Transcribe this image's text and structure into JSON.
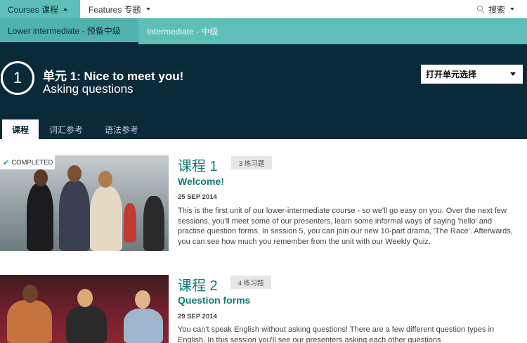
{
  "nav": {
    "courses_label": "Courses 课程",
    "features_label": "Features 专题",
    "search_label": "搜索"
  },
  "levels": {
    "active_label": "Lower intermediate - 预备中级",
    "other_label": "Intermediate - 中级"
  },
  "unit": {
    "number": "1",
    "title": "单元 1: Nice to meet you!",
    "subtitle": "Asking questions",
    "select_label": "打开单元选择"
  },
  "subtabs": {
    "course": "课程",
    "vocab": "词汇参考",
    "grammar": "语法参考"
  },
  "colors": {
    "teal": "#5ebfb8",
    "navy": "#0a2a3a",
    "lesson_title": "#117a76"
  },
  "lessons": [
    {
      "number_label": "课程 1",
      "badge": "3 练习题",
      "status": "COMPLETED",
      "title": "Welcome!",
      "date": "25 SEP 2014",
      "description": "This is the first unit of our lower-intermediate course - so we'll go easy on you. Over the next few sessions, you'll meet some of our presenters, learn some informal ways of saying 'hello' and practise question forms. In session 5, you can join our new 10-part drama, 'The Race'. Afterwards, you can see how much you remember from the unit with our Weekly Quiz."
    },
    {
      "number_label": "课程 2",
      "badge": "4 练习题",
      "title": "Question forms",
      "date": "29 SEP 2014",
      "description": "You can't speak English without asking questions! There are a few different question types in English. In this session you'll see our presenters asking each other questions"
    }
  ]
}
